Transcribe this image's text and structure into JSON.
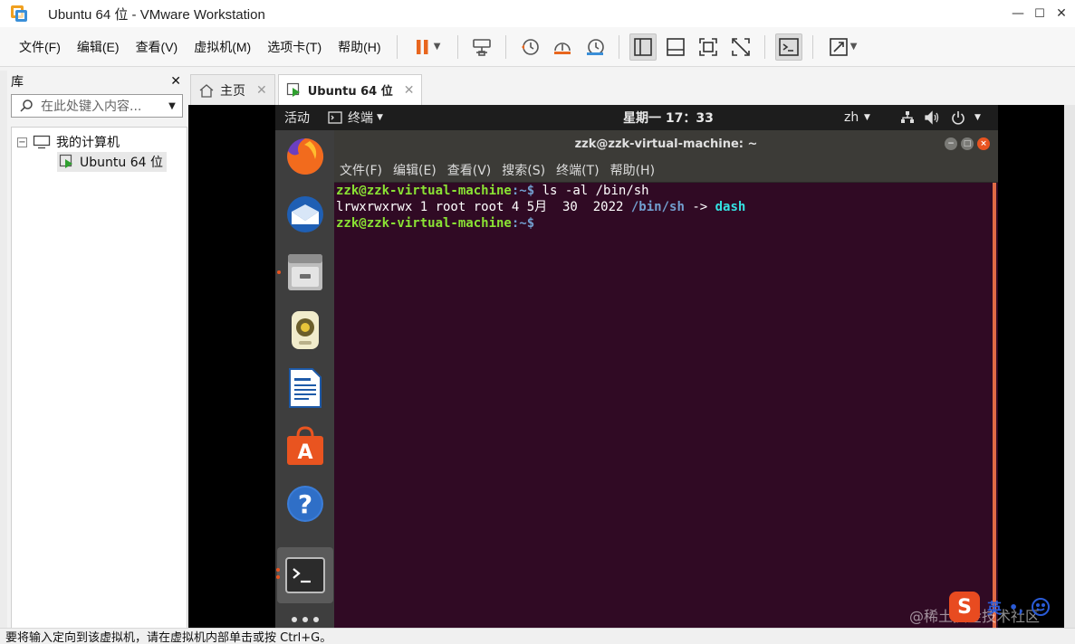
{
  "window": {
    "title": "Ubuntu 64 位 - VMware Workstation",
    "minimize": "—",
    "maximize": "☐",
    "close": "✕"
  },
  "menu": [
    "文件(F)",
    "编辑(E)",
    "查看(V)",
    "虚拟机(M)",
    "选项卡(T)",
    "帮助(H)"
  ],
  "library": {
    "title": "库",
    "close": "✕",
    "search_placeholder": "在此处键入内容...",
    "tree": {
      "root": "我的计算机",
      "child": "Ubuntu 64 位"
    }
  },
  "tabs": [
    {
      "label": "主页",
      "close": "✕"
    },
    {
      "label": "Ubuntu 64 位",
      "close": "✕"
    }
  ],
  "ubuntu": {
    "activities": "活动",
    "app_menu": "终端",
    "clock": "星期一 17：33",
    "lang": "zh"
  },
  "terminal": {
    "title": "zzk@zzk-virtual-machine: ~",
    "menu": [
      "文件(F)",
      "编辑(E)",
      "查看(V)",
      "搜索(S)",
      "终端(T)",
      "帮助(H)"
    ],
    "lines": {
      "l1_user": "zzk@zzk-virtual-machine",
      "l1_path": ":~$",
      "l1_cmd": " ls -al /bin/sh",
      "l2_meta": "lrwxrwxrwx 1 root root 4 5月  30  2022 ",
      "l2_name": "/bin/sh",
      "l2_arrow": " -> ",
      "l2_target": "dash",
      "l3_user": "zzk@zzk-virtual-machine",
      "l3_path": ":~$"
    }
  },
  "status": {
    "text": "要将输入定向到该虚拟机，请在虚拟机内部单击或按 Ctrl+G。"
  },
  "watermark": "@稀土掘金技术社区",
  "ime": {
    "logo": "S",
    "mode": "英"
  },
  "colors": {
    "ubuntu_orange": "#e95420",
    "terminal_bg": "#300a24",
    "prompt_green": "#8ae234",
    "dir_blue": "#729fcf"
  }
}
